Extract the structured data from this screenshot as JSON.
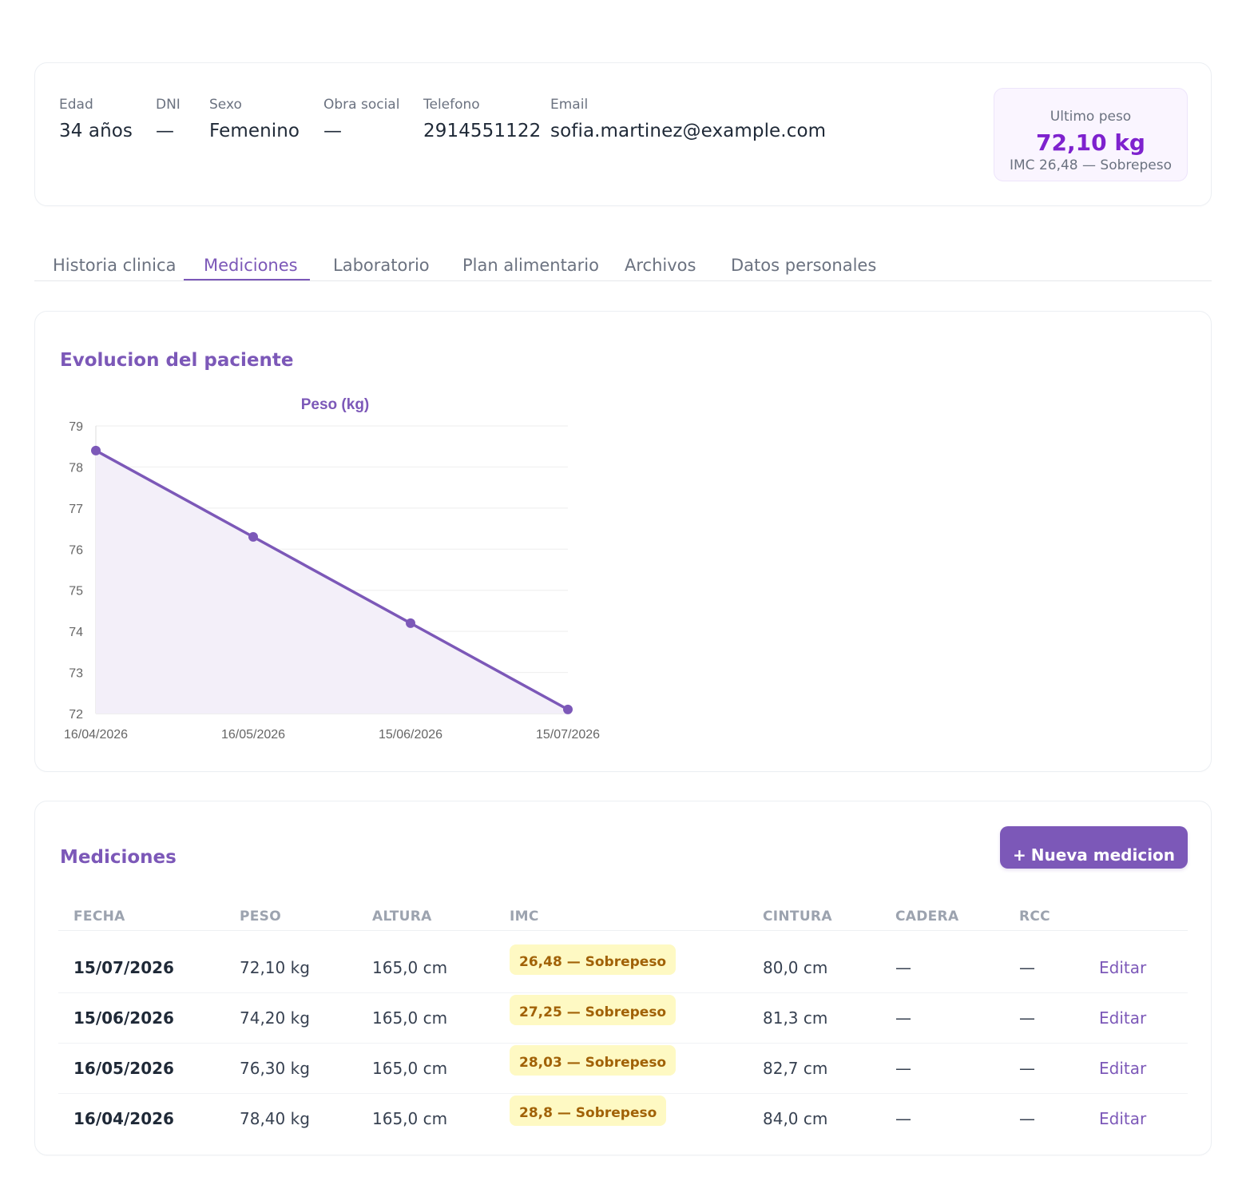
{
  "patient": {
    "fields": [
      {
        "label": "Edad",
        "value": "34 años"
      },
      {
        "label": "DNI",
        "value": "—"
      },
      {
        "label": "Sexo",
        "value": "Femenino"
      },
      {
        "label": "Obra social",
        "value": "—"
      },
      {
        "label": "Telefono",
        "value": "2914551122"
      },
      {
        "label": "Email",
        "value": "sofia.martinez@example.com"
      }
    ],
    "last_weight": {
      "label": "Ultimo peso",
      "value": "72,10 kg",
      "sub": "IMC 26,48 — Sobrepeso"
    }
  },
  "tabs": [
    {
      "label": "Historia clinica",
      "active": false
    },
    {
      "label": "Mediciones",
      "active": true
    },
    {
      "label": "Laboratorio",
      "active": false
    },
    {
      "label": "Plan alimentario",
      "active": false
    },
    {
      "label": "Archivos",
      "active": false
    },
    {
      "label": "Datos personales",
      "active": false
    }
  ],
  "evolution": {
    "title": "Evolucion del paciente"
  },
  "chart_data": {
    "type": "line",
    "title": "Peso (kg)",
    "x": [
      "16/04/2026",
      "16/05/2026",
      "15/06/2026",
      "15/07/2026"
    ],
    "values": [
      78.4,
      76.3,
      74.2,
      72.1
    ],
    "ylim": [
      72,
      79
    ],
    "yticks": [
      72,
      73,
      74,
      75,
      76,
      77,
      78,
      79
    ],
    "grid": true,
    "fill": true,
    "colors": {
      "line": "#7c58b8",
      "fill": "#f3eff9",
      "grid": "#eeeeee"
    }
  },
  "measurements": {
    "title": "Mediciones",
    "new_button": {
      "icon": "+",
      "label": "Nueva medicion"
    },
    "columns": [
      "FECHA",
      "PESO",
      "ALTURA",
      "IMC",
      "CINTURA",
      "CADERA",
      "RCC"
    ],
    "rows": [
      {
        "fecha": "15/07/2026",
        "peso": "72,10 kg",
        "altura": "165,0 cm",
        "imc": "26,48 — Sobrepeso",
        "cintura": "80,0 cm",
        "cadera": "—",
        "rcc": "—",
        "action": "Editar"
      },
      {
        "fecha": "15/06/2026",
        "peso": "74,20 kg",
        "altura": "165,0 cm",
        "imc": "27,25 — Sobrepeso",
        "cintura": "81,3 cm",
        "cadera": "—",
        "rcc": "—",
        "action": "Editar"
      },
      {
        "fecha": "16/05/2026",
        "peso": "76,30 kg",
        "altura": "165,0 cm",
        "imc": "28,03 — Sobrepeso",
        "cintura": "82,7 cm",
        "cadera": "—",
        "rcc": "—",
        "action": "Editar"
      },
      {
        "fecha": "16/04/2026",
        "peso": "78,40 kg",
        "altura": "165,0 cm",
        "imc": "28,8 — Sobrepeso",
        "cintura": "84,0 cm",
        "cadera": "—",
        "rcc": "—",
        "action": "Editar"
      }
    ]
  }
}
